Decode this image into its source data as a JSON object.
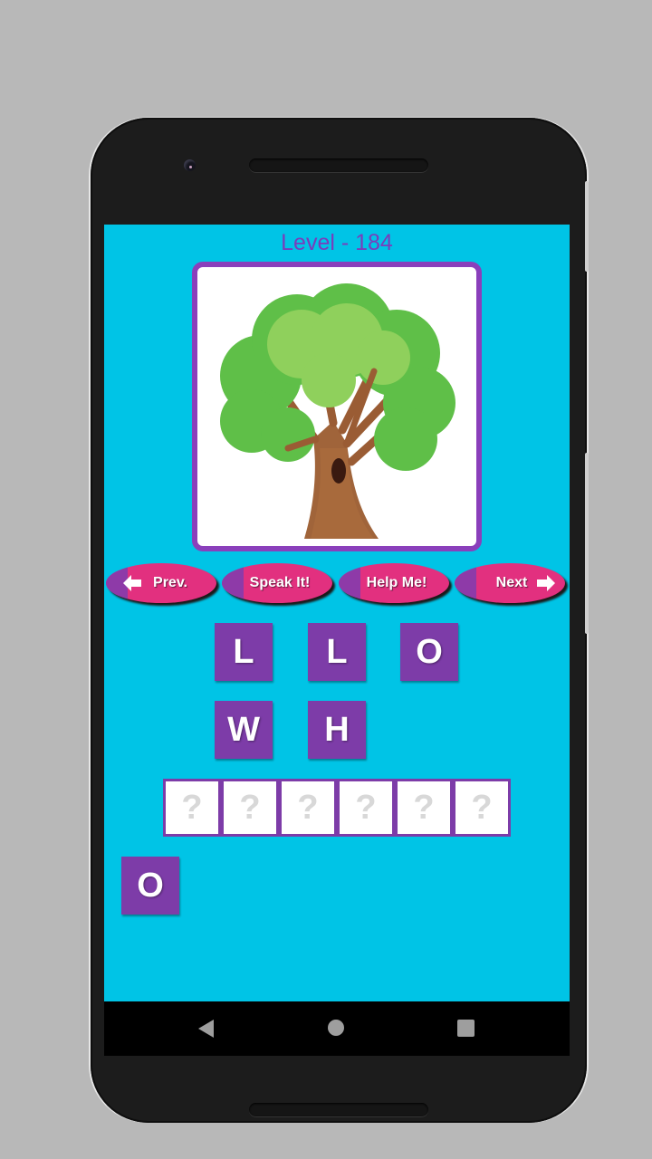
{
  "game": {
    "level_label": "Level - 184",
    "image_subject": "tree",
    "buttons": {
      "prev": "Prev.",
      "speak": "Speak It!",
      "help": "Help Me!",
      "next": "Next"
    },
    "letter_tiles": [
      "L",
      "L",
      "O",
      "W",
      "H"
    ],
    "answer_slots": [
      "?",
      "?",
      "?",
      "?",
      "?",
      "?"
    ],
    "extra_tile": "O"
  },
  "nav": {
    "back_icon": "back-triangle",
    "home_icon": "home-circle",
    "recents_icon": "recents-square"
  },
  "colors": {
    "screen_bg": "#00c4e6",
    "accent_purple": "#7d3ca8",
    "button_pink": "#e2307f"
  }
}
